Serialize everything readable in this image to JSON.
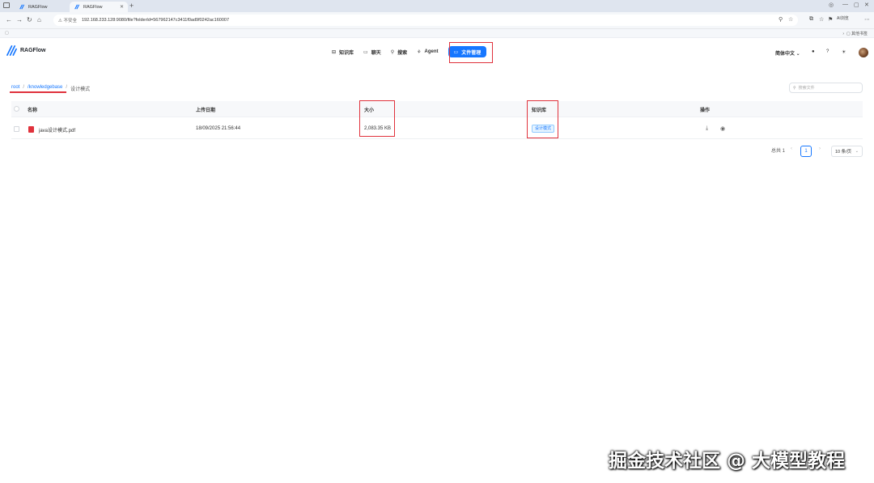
{
  "browser": {
    "tabs": [
      {
        "label": "RAGFlow",
        "active": false
      },
      {
        "label": "RAGFlow",
        "active": true
      }
    ],
    "address": {
      "security": "不安全",
      "url": "192.168.233.128:9080/file?folderId=567962147c3411f0ad9f0242ac160007"
    },
    "ai_label": "AI浏览",
    "bookmarks_right": "其他书签"
  },
  "app": {
    "logo_text": "RAGFlow",
    "nav": [
      {
        "label": "知识库",
        "icon": "database-icon"
      },
      {
        "label": "聊天",
        "icon": "chat-icon"
      },
      {
        "label": "搜索",
        "icon": "search-icon"
      },
      {
        "label": "Agent",
        "icon": "agent-icon"
      },
      {
        "label": "文件管理",
        "icon": "folder-icon",
        "active": true
      }
    ],
    "language": "简体中文",
    "accent_color": "#1677ff",
    "highlight_color": "#e0323c"
  },
  "breadcrumb": {
    "root": "root",
    "kb": "/knowledgebase",
    "current": "设计模式"
  },
  "search": {
    "placeholder": "搜索文件"
  },
  "table": {
    "headers": {
      "name": "名称",
      "upload_date": "上传日期",
      "size": "大小",
      "knowledge_base": "知识库",
      "actions": "操作"
    },
    "rows": [
      {
        "name": "java设计模式.pdf",
        "upload_date": "18/09/2025 21:56:44",
        "size": "2,083.35 KB",
        "knowledge_base": "设计模式"
      }
    ]
  },
  "pagination": {
    "total": "总共 1",
    "current_page": "1",
    "page_size": "10 条/页"
  },
  "watermark": "掘金技术社区 @ 大模型教程"
}
